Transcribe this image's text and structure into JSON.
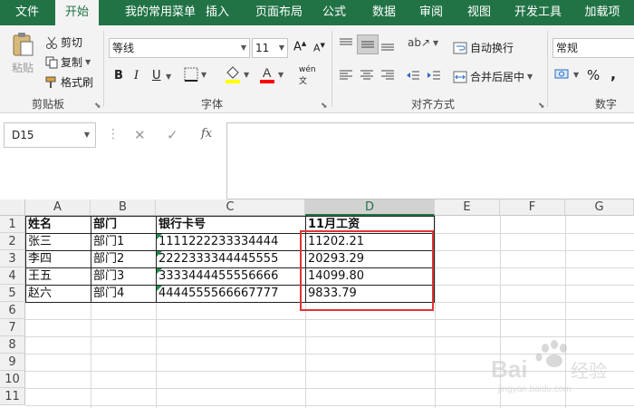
{
  "tabs": [
    "文件",
    "开始",
    "我的常用菜单",
    "插入",
    "页面布局",
    "公式",
    "数据",
    "审阅",
    "视图",
    "开发工具",
    "加载项"
  ],
  "ribbon": {
    "clipboard": {
      "paste": "粘贴",
      "cut": "剪切",
      "copy": "复制",
      "format_painter": "格式刷",
      "group": "剪贴板"
    },
    "font": {
      "name": "等线",
      "size": "11",
      "bold": "B",
      "italic": "I",
      "underline": "U",
      "group": "字体",
      "highlight_color": "#ffff00",
      "font_color": "#ff0000"
    },
    "alignment": {
      "wrap": "自动换行",
      "merge": "合并后居中",
      "group": "对齐方式"
    },
    "number": {
      "format": "常规",
      "percent": "%",
      "comma": ",",
      "group": "数字"
    }
  },
  "formula_bar": {
    "name_box": "D15",
    "fx": "fx",
    "formula": ""
  },
  "sheet": {
    "columns": [
      "A",
      "B",
      "C",
      "D",
      "E",
      "F",
      "G"
    ],
    "selected_column": "D",
    "row_numbers": [
      "1",
      "2",
      "3",
      "4",
      "5",
      "6",
      "7",
      "8",
      "9",
      "10",
      "11"
    ],
    "header_row": [
      "姓名",
      "部门",
      "银行卡号",
      "11月工资"
    ],
    "rows": [
      [
        "张三",
        "部门1",
        "1111222233334444",
        "11202.21"
      ],
      [
        "李四",
        "部门2",
        "2222333344445555",
        "20293.29"
      ],
      [
        "王五",
        "部门3",
        "3333444455556666",
        "14099.80"
      ],
      [
        "赵六",
        "部门4",
        "4444555566667777",
        "9833.79"
      ]
    ]
  },
  "watermark": {
    "text": "Baidu经验",
    "sub": "jingyan.baidu.com"
  },
  "colors": {
    "accent": "#217346",
    "highlight_box": "#e03535"
  }
}
